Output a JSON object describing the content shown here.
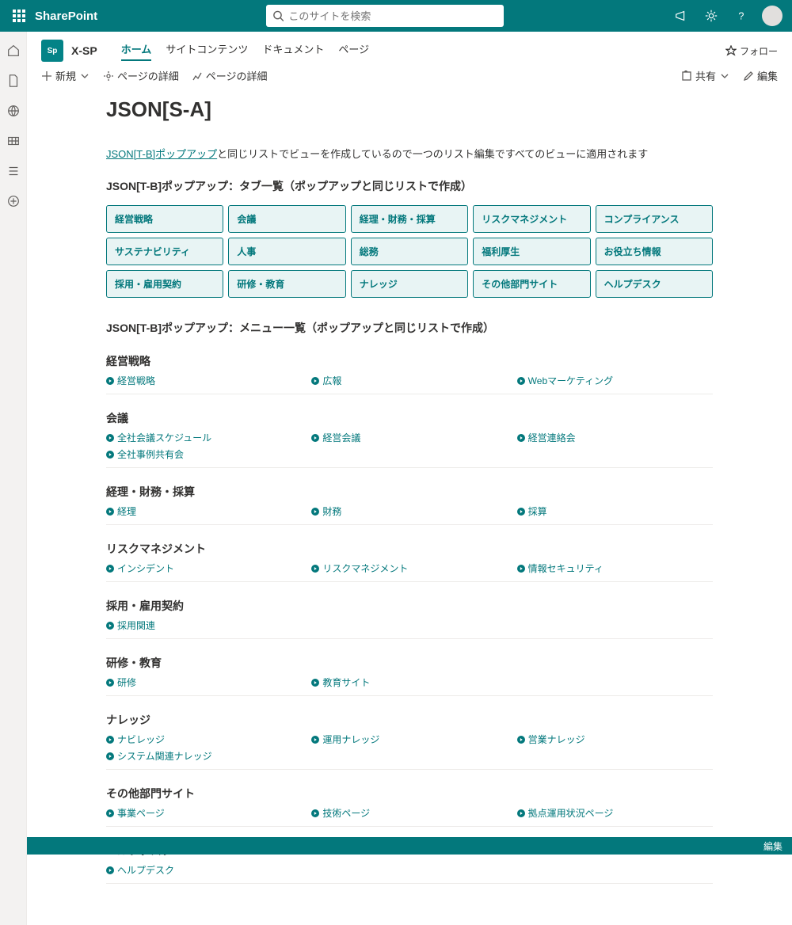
{
  "suite": {
    "brand": "SharePoint",
    "search_placeholder": "このサイトを検索"
  },
  "site": {
    "name": "X-SP",
    "logo_text": "Sp",
    "tabs": [
      {
        "label": "ホーム",
        "active": true
      },
      {
        "label": "サイトコンテンツ",
        "active": false
      },
      {
        "label": "ドキュメント",
        "active": false
      },
      {
        "label": "ページ",
        "active": false
      }
    ],
    "follow": "フォロー"
  },
  "cmd": {
    "new": "新規",
    "details1": "ページの詳細",
    "details2": "ページの詳細",
    "share": "共有",
    "edit": "編集"
  },
  "page": {
    "title": "JSON[S-A]",
    "intro_link": "JSON[T-B]ポップアップ",
    "intro_suffix": "と同じリストでビューを作成しているので一つのリスト編集ですべてのビューに適用されます",
    "tabs_heading": "JSON[T-B]ポップアップ：タブ一覧（ポップアップと同じリストで作成）",
    "menus_heading": "JSON[T-B]ポップアップ：メニュー一覧（ポップアップと同じリストで作成）"
  },
  "tab_grid": [
    "経営戦略",
    "会議",
    "経理・財務・採算",
    "リスクマネジメント",
    "コンプライアンス",
    "サステナビリティ",
    "人事",
    "総務",
    "福利厚生",
    "お役立ち情報",
    "採用・雇用契約",
    "研修・教育",
    "ナレッジ",
    "その他部門サイト",
    "ヘルプデスク"
  ],
  "menu_categories": [
    {
      "name": "経営戦略",
      "items": [
        "経営戦略",
        "広報",
        "Webマーケティング"
      ]
    },
    {
      "name": "会議",
      "items": [
        "全社会議スケジュール",
        "経営会議",
        "経営連絡会",
        "全社事例共有会"
      ]
    },
    {
      "name": "経理・財務・採算",
      "items": [
        "経理",
        "財務",
        "採算"
      ]
    },
    {
      "name": "リスクマネジメント",
      "items": [
        "インシデント",
        "リスクマネジメント",
        "情報セキュリティ"
      ]
    },
    {
      "name": "採用・雇用契約",
      "items": [
        "採用関連"
      ]
    },
    {
      "name": "研修・教育",
      "items": [
        "研修",
        "教育サイト"
      ]
    },
    {
      "name": "ナレッジ",
      "items": [
        "ナビレッジ",
        "運用ナレッジ",
        "営業ナレッジ",
        "システム関連ナレッジ"
      ]
    },
    {
      "name": "その他部門サイト",
      "items": [
        "事業ページ",
        "技術ページ",
        "拠点運用状況ページ"
      ]
    },
    {
      "name": "ヘルプデスク",
      "items": [
        "ヘルプデスク"
      ]
    }
  ],
  "footer": {
    "edit": "編集"
  }
}
